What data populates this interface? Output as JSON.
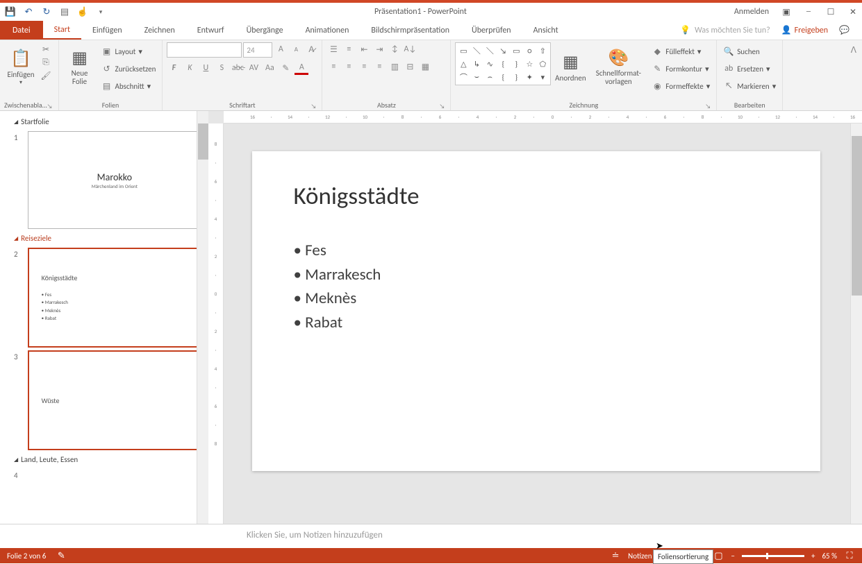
{
  "titlebar": {
    "title": "Präsentation1  -  PowerPoint",
    "login": "Anmelden"
  },
  "tabs": {
    "file": "Datei",
    "home": "Start",
    "insert": "Einfügen",
    "draw": "Zeichnen",
    "design": "Entwurf",
    "transitions": "Übergänge",
    "animations": "Animationen",
    "slideshow": "Bildschirmpräsentation",
    "review": "Überprüfen",
    "view": "Ansicht",
    "tellme": "Was möchten Sie tun?",
    "share": "Freigeben"
  },
  "ribbon": {
    "clipboard": {
      "label": "Zwischenabla…",
      "paste": "Einfügen"
    },
    "slides": {
      "label": "Folien",
      "new": "Neue\nFolie",
      "layout": "Layout",
      "reset": "Zurücksetzen",
      "section": "Abschnitt"
    },
    "font": {
      "label": "Schriftart",
      "size": "24"
    },
    "paragraph": {
      "label": "Absatz"
    },
    "drawing": {
      "label": "Zeichnung",
      "arrange": "Anordnen",
      "quick": "Schnellformat-\nvorlagen",
      "fill": "Fülleffekt",
      "outline": "Formkontur",
      "effects": "Formeffekte"
    },
    "editing": {
      "label": "Bearbeiten",
      "find": "Suchen",
      "replace": "Ersetzen",
      "select": "Markieren"
    }
  },
  "sections": {
    "s1": "Startfolie",
    "s2": "Reiseziele",
    "s3": "Land, Leute, Essen"
  },
  "thumbs": {
    "n1": "1",
    "n2": "2",
    "n3": "3",
    "n4": "4",
    "t1_title": "Marokko",
    "t1_sub": "Märchenland im Orient",
    "t2_title": "Königsstädte",
    "t2_b": {
      "a": "Fes",
      "b": "Marrakesch",
      "c": "Meknès",
      "d": "Rabat"
    },
    "t3_title": "Wüste"
  },
  "slide": {
    "title": "Königsstädte",
    "bullets": {
      "a": "Fes",
      "b": "Marrakesch",
      "c": "Meknès",
      "d": "Rabat"
    }
  },
  "notes": {
    "placeholder": "Klicken Sie, um Notizen hinzuzufügen"
  },
  "status": {
    "count": "Folie 2 von 6",
    "notes": "Notizen",
    "zoom": "65 %"
  },
  "tooltip": {
    "text": "Foliensortierung"
  },
  "ruler_h": [
    "16",
    "",
    "14",
    "",
    "12",
    "",
    "10",
    "",
    "8",
    "",
    "6",
    "",
    "4",
    "",
    "2",
    "",
    "0",
    "",
    "2",
    "",
    "4",
    "",
    "6",
    "",
    "8",
    "",
    "10",
    "",
    "12",
    "",
    "14",
    "",
    "16"
  ],
  "ruler_v": [
    "8",
    "",
    "6",
    "",
    "4",
    "",
    "2",
    "",
    "0",
    "",
    "2",
    "",
    "4",
    "",
    "6",
    "",
    "8"
  ]
}
